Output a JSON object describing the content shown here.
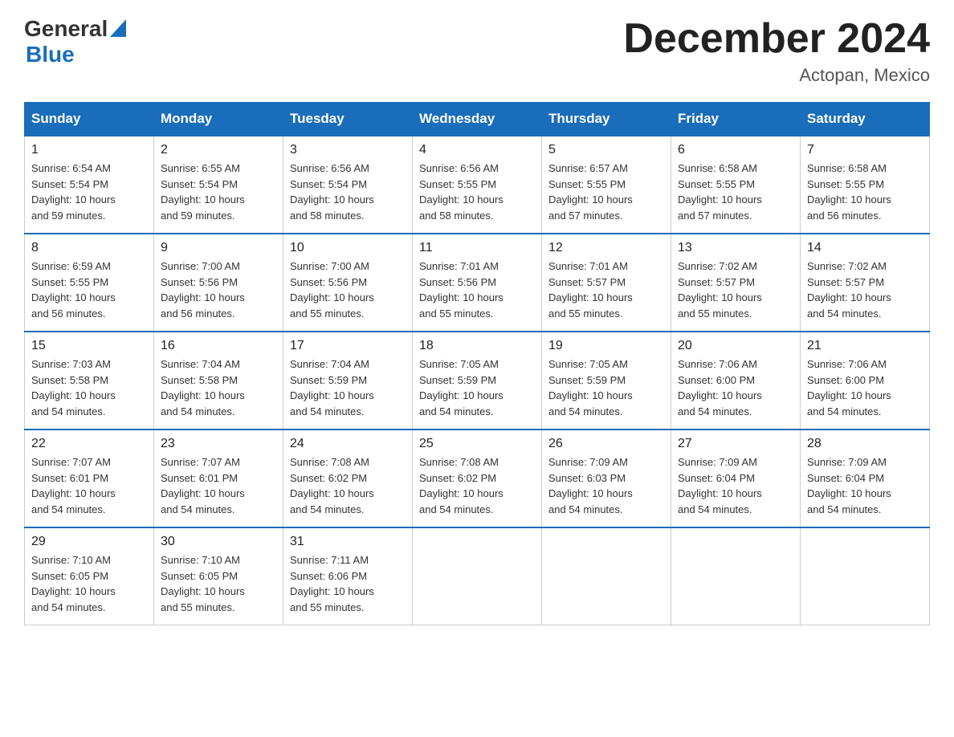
{
  "header": {
    "logo_general": "General",
    "logo_blue": "Blue",
    "month_title": "December 2024",
    "location": "Actopan, Mexico"
  },
  "days_of_week": [
    "Sunday",
    "Monday",
    "Tuesday",
    "Wednesday",
    "Thursday",
    "Friday",
    "Saturday"
  ],
  "weeks": [
    [
      {
        "day": "1",
        "sunrise": "6:54 AM",
        "sunset": "5:54 PM",
        "daylight": "10 hours and 59 minutes."
      },
      {
        "day": "2",
        "sunrise": "6:55 AM",
        "sunset": "5:54 PM",
        "daylight": "10 hours and 59 minutes."
      },
      {
        "day": "3",
        "sunrise": "6:56 AM",
        "sunset": "5:54 PM",
        "daylight": "10 hours and 58 minutes."
      },
      {
        "day": "4",
        "sunrise": "6:56 AM",
        "sunset": "5:55 PM",
        "daylight": "10 hours and 58 minutes."
      },
      {
        "day": "5",
        "sunrise": "6:57 AM",
        "sunset": "5:55 PM",
        "daylight": "10 hours and 57 minutes."
      },
      {
        "day": "6",
        "sunrise": "6:58 AM",
        "sunset": "5:55 PM",
        "daylight": "10 hours and 57 minutes."
      },
      {
        "day": "7",
        "sunrise": "6:58 AM",
        "sunset": "5:55 PM",
        "daylight": "10 hours and 56 minutes."
      }
    ],
    [
      {
        "day": "8",
        "sunrise": "6:59 AM",
        "sunset": "5:55 PM",
        "daylight": "10 hours and 56 minutes."
      },
      {
        "day": "9",
        "sunrise": "7:00 AM",
        "sunset": "5:56 PM",
        "daylight": "10 hours and 56 minutes."
      },
      {
        "day": "10",
        "sunrise": "7:00 AM",
        "sunset": "5:56 PM",
        "daylight": "10 hours and 55 minutes."
      },
      {
        "day": "11",
        "sunrise": "7:01 AM",
        "sunset": "5:56 PM",
        "daylight": "10 hours and 55 minutes."
      },
      {
        "day": "12",
        "sunrise": "7:01 AM",
        "sunset": "5:57 PM",
        "daylight": "10 hours and 55 minutes."
      },
      {
        "day": "13",
        "sunrise": "7:02 AM",
        "sunset": "5:57 PM",
        "daylight": "10 hours and 55 minutes."
      },
      {
        "day": "14",
        "sunrise": "7:02 AM",
        "sunset": "5:57 PM",
        "daylight": "10 hours and 54 minutes."
      }
    ],
    [
      {
        "day": "15",
        "sunrise": "7:03 AM",
        "sunset": "5:58 PM",
        "daylight": "10 hours and 54 minutes."
      },
      {
        "day": "16",
        "sunrise": "7:04 AM",
        "sunset": "5:58 PM",
        "daylight": "10 hours and 54 minutes."
      },
      {
        "day": "17",
        "sunrise": "7:04 AM",
        "sunset": "5:59 PM",
        "daylight": "10 hours and 54 minutes."
      },
      {
        "day": "18",
        "sunrise": "7:05 AM",
        "sunset": "5:59 PM",
        "daylight": "10 hours and 54 minutes."
      },
      {
        "day": "19",
        "sunrise": "7:05 AM",
        "sunset": "5:59 PM",
        "daylight": "10 hours and 54 minutes."
      },
      {
        "day": "20",
        "sunrise": "7:06 AM",
        "sunset": "6:00 PM",
        "daylight": "10 hours and 54 minutes."
      },
      {
        "day": "21",
        "sunrise": "7:06 AM",
        "sunset": "6:00 PM",
        "daylight": "10 hours and 54 minutes."
      }
    ],
    [
      {
        "day": "22",
        "sunrise": "7:07 AM",
        "sunset": "6:01 PM",
        "daylight": "10 hours and 54 minutes."
      },
      {
        "day": "23",
        "sunrise": "7:07 AM",
        "sunset": "6:01 PM",
        "daylight": "10 hours and 54 minutes."
      },
      {
        "day": "24",
        "sunrise": "7:08 AM",
        "sunset": "6:02 PM",
        "daylight": "10 hours and 54 minutes."
      },
      {
        "day": "25",
        "sunrise": "7:08 AM",
        "sunset": "6:02 PM",
        "daylight": "10 hours and 54 minutes."
      },
      {
        "day": "26",
        "sunrise": "7:09 AM",
        "sunset": "6:03 PM",
        "daylight": "10 hours and 54 minutes."
      },
      {
        "day": "27",
        "sunrise": "7:09 AM",
        "sunset": "6:04 PM",
        "daylight": "10 hours and 54 minutes."
      },
      {
        "day": "28",
        "sunrise": "7:09 AM",
        "sunset": "6:04 PM",
        "daylight": "10 hours and 54 minutes."
      }
    ],
    [
      {
        "day": "29",
        "sunrise": "7:10 AM",
        "sunset": "6:05 PM",
        "daylight": "10 hours and 54 minutes."
      },
      {
        "day": "30",
        "sunrise": "7:10 AM",
        "sunset": "6:05 PM",
        "daylight": "10 hours and 55 minutes."
      },
      {
        "day": "31",
        "sunrise": "7:11 AM",
        "sunset": "6:06 PM",
        "daylight": "10 hours and 55 minutes."
      },
      null,
      null,
      null,
      null
    ]
  ]
}
